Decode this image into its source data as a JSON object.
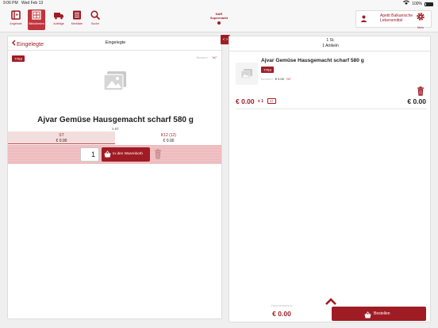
{
  "status_bar": {
    "time": "9:06 PM",
    "date": "Wed Feb 13",
    "battery": "100%"
  },
  "toolbar": {
    "items": [
      {
        "label": "Angebote",
        "icon": "book-icon"
      },
      {
        "label": "Bibliotheken",
        "icon": "grid-icon"
      },
      {
        "label": "Aufträge",
        "icon": "truck-icon"
      },
      {
        "label": "Merkliste",
        "icon": "list-icon"
      },
      {
        "label": "Suche",
        "icon": "search-icon"
      }
    ],
    "market": [
      "NAR",
      "Supermarkt"
    ],
    "user_name": "Apetit Balkanische Lebensmittel",
    "menu_label": "Mehr"
  },
  "left": {
    "back_label": "Eingelegte",
    "title": "Eingelegte",
    "tag": "7753",
    "meta_label": "Bestand",
    "meta_vat": "%7",
    "product_name": "Ajvar Gemüse Hausgemacht scharf 580 g",
    "stock": "0 ST",
    "units": [
      {
        "name": "ST",
        "price": "€ 0.00"
      },
      {
        "name": "K12 (12)",
        "price": "€ 0.00"
      }
    ],
    "quantity": "1",
    "add_to_cart_label": "In den Warenkorb"
  },
  "toggle_label": "< >",
  "right": {
    "head_count": "1 St.",
    "head_articles": "1 Artikeln",
    "item": {
      "name": "Ajvar Gemüse Hausgemacht scharf 580 g",
      "tag": "7753",
      "meta_label": "Bestand",
      "meta_price": "€ 0.00",
      "meta_vat": "%7",
      "price": "€ 0.00",
      "x": "x 1",
      "unit": "ST",
      "total": "€ 0.00"
    },
    "sum_label": "Zwischensumme",
    "sum_value": "€ 0.00",
    "order_label": "Bestellen"
  },
  "colors": {
    "accent": "#a01c24",
    "selected_tab": "#c0353d"
  }
}
